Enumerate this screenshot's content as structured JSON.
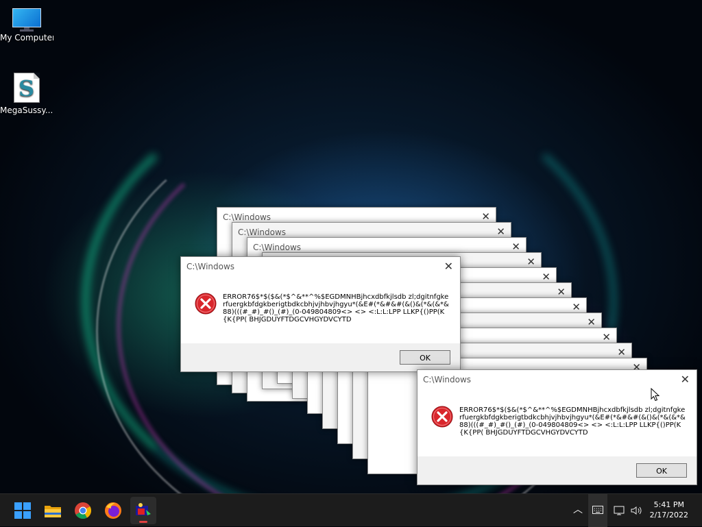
{
  "desktop": {
    "icons": [
      {
        "label": "My Computer",
        "icon": "monitor-icon"
      },
      {
        "label": "MegaSussy....",
        "icon": "script-file-icon"
      }
    ]
  },
  "dialog": {
    "title": "C:\\Windows",
    "close_glyph": "✕",
    "message": "ERROR76$*$($&(*$^&**^%$EGDMNHBjhcxdbfkjlsdb zl;dgitnfgkerfuergkbfdgkberigtbdkcbhjvjhbvjhgyu*(&E#(*&#&#(&()&(*&(&*&88)(((#_#)_#()_(#)_(0-049804809<> <> <:L:L:LPP LLKP{()PP(K{K{PP( BHJGDUYFTDGCVHGYDVCYTD",
    "ok_label": "OK"
  },
  "stack_dialog_title": "C:\\Windows",
  "taskbar": {
    "apps": [
      "start-icon",
      "file-explorer-icon",
      "chrome-icon",
      "firefox-icon",
      "malware-app-icon"
    ],
    "time": "5:41 PM",
    "date": "2/17/2022"
  },
  "colors": {
    "error_red": "#d9262c",
    "taskbar_bg": "#1c1c1c",
    "active_indicator": "#e04040"
  }
}
